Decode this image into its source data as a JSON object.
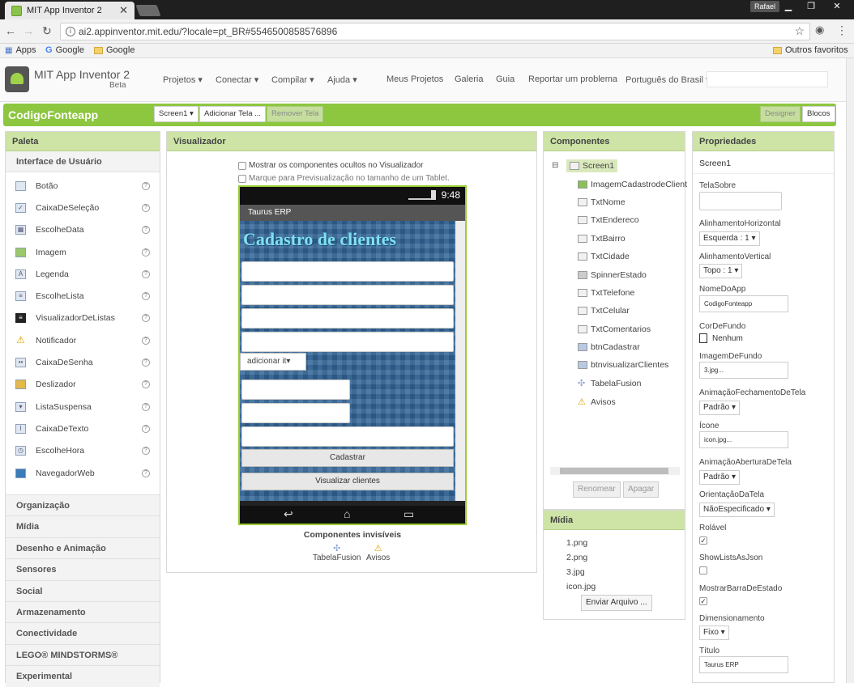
{
  "browser": {
    "tab_title": "MIT App Inventor 2",
    "user_badge": "Rafael",
    "url": "ai2.appinventor.mit.edu/?locale=pt_BR#5546500858576896",
    "bookmarks": [
      "Apps",
      "Google",
      "Google"
    ],
    "other_bookmarks": "Outros favoritos"
  },
  "header": {
    "title": "MIT App Inventor 2",
    "beta": "Beta",
    "menus": [
      "Projetos ▾",
      "Conectar ▾",
      "Compilar ▾",
      "Ajuda ▾",
      "Meus Projetos",
      "Galeria",
      "Guia",
      "Reportar um problema",
      "Português do Brasil ▾"
    ]
  },
  "projectbar": {
    "name": "CodigoFonteapp",
    "screen_select": "Screen1 ▾",
    "add_screen": "Adicionar Tela ...",
    "remove_screen": "Remover Tela",
    "designer": "Designer",
    "blocks": "Blocos"
  },
  "palette": {
    "title": "Paleta",
    "section": "Interface de Usuário",
    "items": [
      "Botão",
      "CaixaDeSeleção",
      "EscolheData",
      "Imagem",
      "Legenda",
      "EscolheLista",
      "VisualizadorDeListas",
      "Notificador",
      "CaixaDeSenha",
      "Deslizador",
      "ListaSuspensa",
      "CaixaDeTexto",
      "EscolheHora",
      "NavegadorWeb"
    ],
    "help": "?",
    "categories": [
      "Organização",
      "Mídia",
      "Desenho e Animação",
      "Sensores",
      "Social",
      "Armazenamento",
      "Conectividade",
      "LEGO® MINDSTORMS®",
      "Experimental"
    ]
  },
  "viewer": {
    "title": "Visualizador",
    "show_hidden": "Mostrar os componentes ocultos no Visualizador",
    "tablet_preview": "Marque para Previsualização no tamanho de um Tablet.",
    "phone": {
      "time": "9:48",
      "app_title": "Taurus ERP",
      "heading": "Cadastro de clientes",
      "spinner": "adicionar it▾",
      "btn_register": "Cadastrar",
      "btn_view": "Visualizar clientes"
    },
    "invisible_title": "Componentes invisíveis",
    "invisible": [
      "TabelaFusion",
      "Avisos"
    ]
  },
  "components": {
    "title": "Componentes",
    "root": "Screen1",
    "items": [
      "ImagemCadastrodeClient",
      "TxtNome",
      "TxtEndereco",
      "TxtBairro",
      "TxtCidade",
      "SpinnerEstado",
      "TxtTelefone",
      "TxtCelular",
      "TxtComentarios",
      "btnCadastrar",
      "btnvisualizarClientes",
      "TabelaFusion",
      "Avisos"
    ],
    "rename": "Renomear",
    "delete": "Apagar"
  },
  "media": {
    "title": "Mídia",
    "files": [
      "1.png",
      "2.png",
      "3.jpg",
      "icon.jpg"
    ],
    "upload": "Enviar Arquivo ..."
  },
  "properties": {
    "title": "Propriedades",
    "component": "Screen1",
    "about_label": "TelaSobre",
    "halign_label": "AlinhamentoHorizontal",
    "halign_value": "Esquerda : 1 ▾",
    "valign_label": "AlinhamentoVertical",
    "valign_value": "Topo : 1 ▾",
    "appname_label": "NomeDoApp",
    "appname_value": "CodigoFonteapp",
    "bgcolor_label": "CorDeFundo",
    "bgcolor_value": "Nenhum",
    "bgimage_label": "ImagemDeFundo",
    "bgimage_value": "3.jpg...",
    "closeanim_label": "AnimaçãoFechamentoDeTela",
    "closeanim_value": "Padrão ▾",
    "icon_label": "Ícone",
    "icon_value": "icon.jpg...",
    "openanim_label": "AnimaçãoAberturaDeTela",
    "openanim_value": "Padrão ▾",
    "orientation_label": "OrientaçãoDaTela",
    "orientation_value": "NãoEspecificado ▾",
    "scrollable_label": "Rolável",
    "showlists_label": "ShowListsAsJson",
    "statusbar_label": "MostrarBarraDeEstado",
    "sizing_label": "Dimensionamento",
    "sizing_value": "Fixo ▾",
    "title_label": "Título",
    "title_value": "Taurus ERP"
  },
  "colors": {
    "accent": "#8dc63f",
    "panel_head": "#cde4a6"
  }
}
